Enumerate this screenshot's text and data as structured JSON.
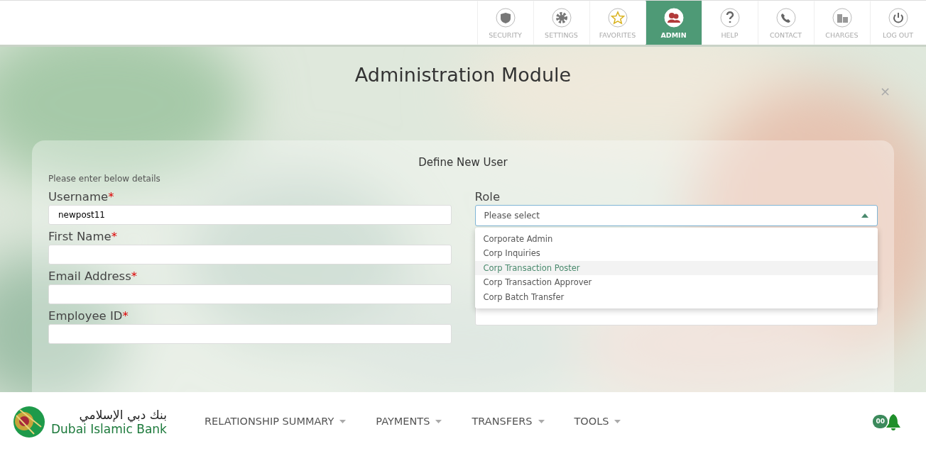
{
  "top_nav": [
    {
      "label": "SECURITY",
      "selected": false
    },
    {
      "label": "SETTINGS",
      "selected": false
    },
    {
      "label": "FAVORITES",
      "selected": false
    },
    {
      "label": "ADMIN",
      "selected": true
    },
    {
      "label": "HELP",
      "selected": false
    },
    {
      "label": "CONTACT",
      "selected": false
    },
    {
      "label": "CHARGES",
      "selected": false
    },
    {
      "label": "LOG OUT",
      "selected": false
    }
  ],
  "modal": {
    "title": "Administration Module",
    "close": "×",
    "form": {
      "title": "Define New User",
      "instructions": "Please enter below details",
      "left_fields": [
        {
          "label": "Username",
          "required": "*",
          "value": "newpost11"
        },
        {
          "label": "First Name",
          "required": "*"
        },
        {
          "label": "Email Address",
          "required": "*"
        },
        {
          "label": "Employee ID",
          "required": "*"
        }
      ],
      "role": {
        "label": "Role",
        "placeholder": "Please select",
        "expanded": true,
        "options": [
          {
            "label": "Corporate Admin",
            "selected": false
          },
          {
            "label": "Corp Inquiries",
            "selected": false
          },
          {
            "label": "Corp Transaction Poster",
            "selected": true
          },
          {
            "label": "Corp Transaction Approver",
            "selected": false
          },
          {
            "label": "Corp Batch Transfer",
            "selected": false
          }
        ]
      }
    }
  },
  "footer": {
    "logo_arabic": "بنك دبي الإسلامي",
    "logo_english": "Dubai Islamic Bank",
    "menu": [
      "RELATIONSHIP SUMMARY",
      "PAYMENTS",
      "TRANSFERS",
      "TOOLS"
    ],
    "notification_count": "00"
  }
}
